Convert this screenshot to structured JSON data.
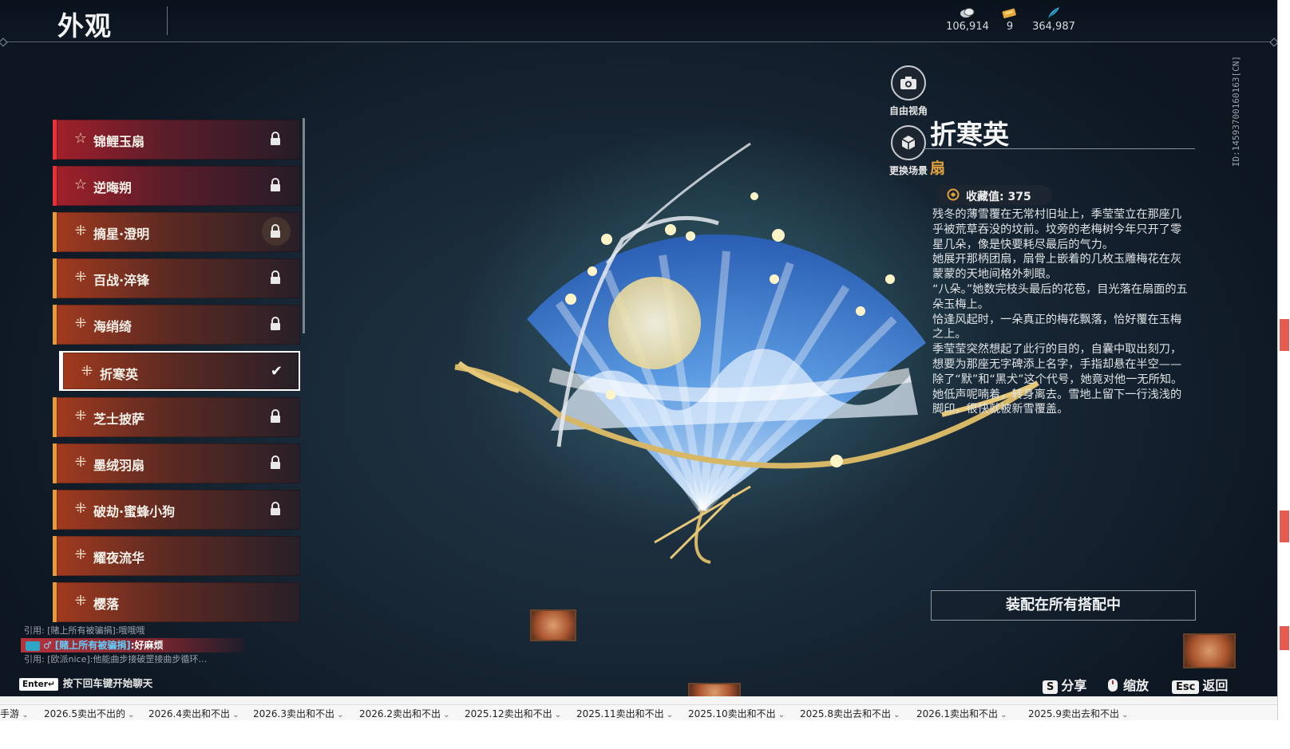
{
  "header": {
    "title": "外观"
  },
  "currencies": [
    {
      "icon": "coin-stack-icon",
      "value": "106,914"
    },
    {
      "icon": "ticket-icon",
      "value": "9"
    },
    {
      "icon": "feather-icon",
      "value": "364,987"
    }
  ],
  "items": [
    {
      "label": "锦鲤玉扇",
      "tier": "red",
      "locked": true
    },
    {
      "label": "逆晦朔",
      "tier": "red",
      "locked": true
    },
    {
      "label": "摘星·澄明",
      "tier": "orange",
      "locked": true
    },
    {
      "label": "百战·淬锋",
      "tier": "orange",
      "locked": true
    },
    {
      "label": "海绡绮",
      "tier": "orange",
      "locked": true
    },
    {
      "label": "折寒英",
      "tier": "orange",
      "selected": true
    },
    {
      "label": "芝士披萨",
      "tier": "orange",
      "locked": true
    },
    {
      "label": "墨绒羽扇",
      "tier": "orange",
      "locked": true
    },
    {
      "label": "破劫·蜜蜂小狗",
      "tier": "orange",
      "locked": true
    },
    {
      "label": "耀夜流华",
      "tier": "orange",
      "locked": false
    },
    {
      "label": "樱落",
      "tier": "orange",
      "locked": false
    }
  ],
  "camera": {
    "free_view": "自由视角",
    "change_scene": "更换场景"
  },
  "detail": {
    "name": "折寒英",
    "category": "扇",
    "collect_label": "收藏值: 375",
    "story": [
      "残冬的薄雪覆在无常村旧址上，季莹莹立在那座几乎被荒草吞没的坟前。坟旁的老梅树今年只开了零星几朵，像是快要耗尽最后的气力。",
      "她展开那柄团扇，扇骨上嵌着的几枚玉雕梅花在灰蒙蒙的天地间格外刺眼。",
      "“八朵。”她数完枝头最后的花苞，目光落在扇面的五朵玉梅上。",
      "恰逢风起时，一朵真正的梅花飘落，恰好覆在玉梅之上。",
      "季莹莹突然想起了此行的目的，自囊中取出刻刀，想要为那座无字碑添上名字，手指却悬在半空——除了“默”和“黑犬”这个代号，她竟对他一无所知。",
      "她低声呢喃着，转身离去。雪地上留下一行浅浅的脚印，很快就被新雪覆盖。"
    ],
    "equip_button": "装配在所有搭配中",
    "id_text": "ID:1459370016016​3[CN]"
  },
  "chat": {
    "line1": "引用: [赌上所有被骗捐]:哦哦哦",
    "line2_who": "[赌上所有被骗捐]",
    "line2_msg": ":好麻烦",
    "line3": "引用: [欧派nice]:他能曲步接破罡接曲步循环…",
    "enter_key": "Enter↵",
    "hint": "按下回车键开始聊天"
  },
  "actions": [
    {
      "key": "S",
      "label": "分享"
    },
    {
      "key": "",
      "label": "缩放"
    },
    {
      "key": "Esc",
      "label": "返回"
    }
  ],
  "excel_tabs": [
    "手游",
    "2026.5卖出不出的",
    "2026.4卖出和不出",
    "2026.3卖出和不出",
    "2026.2卖出和不出",
    "2025.12卖出和不出",
    "2025.11卖出和不出",
    "2025.10卖出和不出",
    "2025.8卖出去和不出",
    "2026.1卖出和不出",
    "2025.9卖出去和不出"
  ],
  "colors": {
    "accent_orange": "#e2a13c",
    "red_tier": "#e5313a",
    "orange_tier": "#e59b3c"
  }
}
